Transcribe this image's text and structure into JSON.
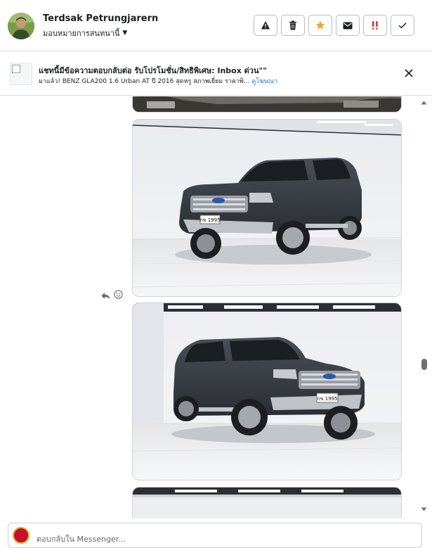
{
  "header": {
    "user_name": "Terdsak Petrungjarern",
    "assign_label": "มอบหมายการสนทนานี้",
    "actions": [
      {
        "name": "report-button",
        "icon": "warning-icon"
      },
      {
        "name": "delete-button",
        "icon": "trash-icon"
      },
      {
        "name": "star-button",
        "icon": "star-icon",
        "color": "#f5a623"
      },
      {
        "name": "mail-button",
        "icon": "envelope-icon"
      },
      {
        "name": "spam-button",
        "icon": "double-exclamation-icon",
        "color": "#e02020"
      },
      {
        "name": "done-button",
        "icon": "checkmark-icon"
      }
    ]
  },
  "banner": {
    "title": "แชทนี้มีข้อความตอบกลับต่อ รับโปรโมชั่น/สิทธิพิเศษ: Inbox ด่วน\"\"",
    "subtitle": "มาแล้ว! BENZ GLA200 1.6 Urban AT ปี 2016 สุดหรู สภาพเยี่ยม ราคาพิ...",
    "link": "ดูโฆษณา"
  },
  "photos": [
    {
      "plate": "กข 1995"
    },
    {
      "plate": "กข 1995"
    }
  ],
  "composer": {
    "placeholder": "ตอบกลับใน Messenger..."
  },
  "colors": {
    "link": "#1877f2",
    "border": "#dadde1"
  }
}
